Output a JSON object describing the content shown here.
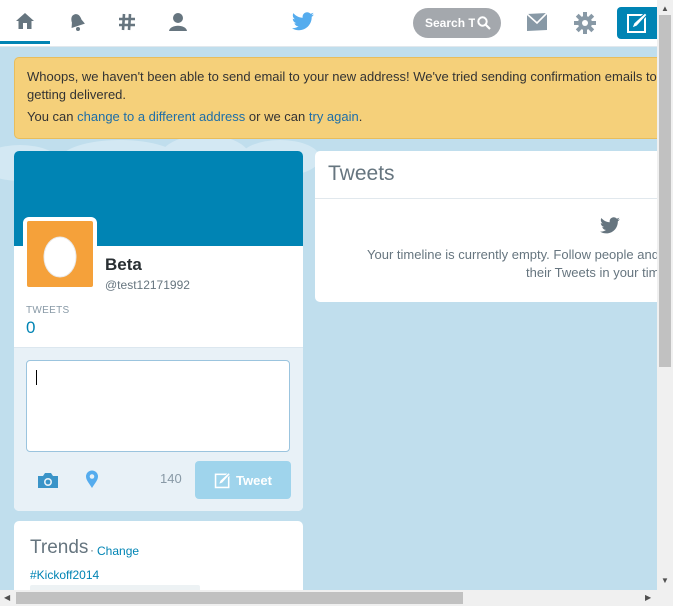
{
  "topbar": {
    "nav": [
      {
        "icon": "home-icon",
        "active": true
      },
      {
        "icon": "notifications-bell-icon",
        "active": false
      },
      {
        "icon": "discover-hash-icon",
        "active": false
      },
      {
        "icon": "me-person-icon",
        "active": false
      }
    ],
    "logo_icon": "twitter-bird-icon",
    "search": {
      "placeholder": "Search Twitter"
    },
    "messages_icon": "envelope-icon",
    "settings_icon": "gear-icon",
    "compose_icon": "compose-pencil-icon",
    "accent_color": "#0084b4"
  },
  "alert": {
    "line1": "Whoops, we haven't been able to send email to your new address! We've tried sending confirmation emails to your address but they're not getting delivered.",
    "line1_visible": "Whoops, we haven't been able to send email to your new address! We've tried sending confirmation emails to",
    "line1_wrap": "getting delivered.",
    "line2_prefix": "You can ",
    "change_link": "change to a different address",
    "line2_middle": " or we can ",
    "retry_link": "try again",
    "line2_suffix": ".",
    "background_color": "#f5d07a"
  },
  "profile": {
    "name": "Beta",
    "handle": "@test12171992",
    "tweets_label": "TWEETS",
    "tweets_count": "0",
    "avatar_icon": "egg-avatar-icon",
    "banner_color": "#0084b4"
  },
  "composer": {
    "placeholder": "",
    "value": "",
    "camera_icon": "camera-icon",
    "location_icon": "location-pin-icon",
    "char_count": "140",
    "tweet_button_label": "Tweet",
    "tweet_button_icon": "compose-pencil-icon"
  },
  "trends": {
    "title": "Trends",
    "separator": "·",
    "change_label": "Change",
    "items": [
      {
        "label": "#Kickoff2014"
      }
    ]
  },
  "timeline": {
    "title": "Tweets",
    "empty_icon": "twitter-bird-icon",
    "empty_line1": "Your timeline is currently empty. Follow people and topics you find interesting to see",
    "empty_line2": "their Tweets in your timeline."
  }
}
